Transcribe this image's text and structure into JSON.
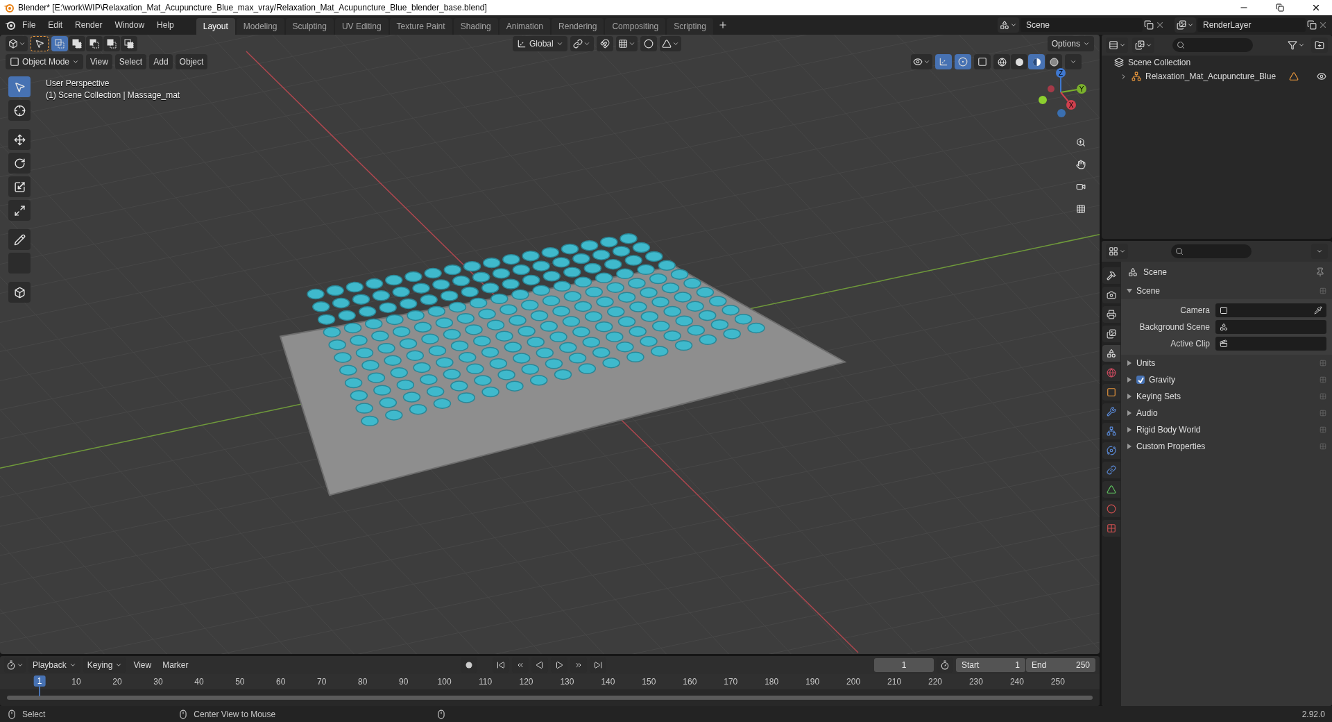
{
  "window": {
    "title": "Blender* [E:\\work\\WIP\\Relaxation_Mat_Acupuncture_Blue_max_vray/Relaxation_Mat_Acupuncture_Blue_blender_base.blend]"
  },
  "menu": [
    "File",
    "Edit",
    "Render",
    "Window",
    "Help"
  ],
  "workspaces": [
    {
      "label": "Layout",
      "selected": true
    },
    {
      "label": "Modeling",
      "selected": false
    },
    {
      "label": "Sculpting",
      "selected": false
    },
    {
      "label": "UV Editing",
      "selected": false
    },
    {
      "label": "Texture Paint",
      "selected": false
    },
    {
      "label": "Shading",
      "selected": false
    },
    {
      "label": "Animation",
      "selected": false
    },
    {
      "label": "Rendering",
      "selected": false
    },
    {
      "label": "Compositing",
      "selected": false
    },
    {
      "label": "Scripting",
      "selected": false
    }
  ],
  "scene": {
    "value": "Scene"
  },
  "view_layer": {
    "value": "RenderLayer"
  },
  "viewport": {
    "select_modes": [
      {
        "kind": "new",
        "selected": true
      },
      {
        "kind": "extend",
        "selected": false
      },
      {
        "kind": "subtract",
        "selected": false
      },
      {
        "kind": "difference",
        "selected": false
      },
      {
        "kind": "intersect",
        "selected": false
      }
    ],
    "orientation": "Global",
    "options": "Options",
    "mode": "Object Mode",
    "menus": [
      "View",
      "Select",
      "Add",
      "Object"
    ],
    "toggles": [
      {
        "kind": "gizmo",
        "on": true
      },
      {
        "kind": "overlay",
        "on": true
      },
      {
        "kind": "xray",
        "on": false
      }
    ],
    "shading": [
      {
        "kind": "wireframe",
        "selected": false
      },
      {
        "kind": "solid",
        "selected": false
      },
      {
        "kind": "material",
        "selected": true
      },
      {
        "kind": "rendered",
        "selected": false
      }
    ],
    "tools": [
      {
        "kind": "select",
        "selected": true
      },
      {
        "kind": "cursor",
        "selected": false
      },
      {
        "kind": "move",
        "selected": false
      },
      {
        "kind": "rotate",
        "selected": false
      },
      {
        "kind": "scale",
        "selected": false
      },
      {
        "kind": "transform",
        "selected": false
      },
      {
        "kind": "annotate",
        "selected": false
      },
      {
        "kind": "measure",
        "selected": false
      },
      {
        "kind": "add_cube",
        "selected": false
      }
    ],
    "overlay_text": [
      "User Perspective",
      "(1) Scene Collection | Massage_mat"
    ],
    "gizmo": {
      "x": "X",
      "y": "Y",
      "z": "Z"
    }
  },
  "outliner": {
    "title": "Scene Collection",
    "items": [
      {
        "label": "Relaxation_Mat_Acupuncture_Blue",
        "expanded": false,
        "visible": true
      }
    ]
  },
  "properties": {
    "tabs": [
      {
        "kind": "tool",
        "selected": false
      },
      {
        "kind": "render",
        "selected": false
      },
      {
        "kind": "output",
        "selected": false
      },
      {
        "kind": "view_layer",
        "selected": false
      },
      {
        "kind": "scene",
        "selected": true
      },
      {
        "kind": "world",
        "selected": false
      },
      {
        "kind": "object",
        "selected": false
      },
      {
        "kind": "modifiers",
        "selected": false
      },
      {
        "kind": "particles",
        "selected": false
      },
      {
        "kind": "physics",
        "selected": false
      },
      {
        "kind": "constraints",
        "selected": false
      },
      {
        "kind": "data",
        "selected": false
      },
      {
        "kind": "material",
        "selected": false
      },
      {
        "kind": "texture",
        "selected": false
      }
    ],
    "context": "Scene",
    "panels": [
      {
        "label": "Scene",
        "expanded": true,
        "fields": [
          {
            "label": "Camera",
            "kind": "camera"
          },
          {
            "label": "Background Scene",
            "kind": "scene"
          },
          {
            "label": "Active Clip",
            "kind": "clip"
          }
        ]
      },
      {
        "label": "Units",
        "expanded": false
      },
      {
        "label": "Gravity",
        "expanded": false,
        "checked": true
      },
      {
        "label": "Keying Sets",
        "expanded": false
      },
      {
        "label": "Audio",
        "expanded": false
      },
      {
        "label": "Rigid Body World",
        "expanded": false
      },
      {
        "label": "Custom Properties",
        "expanded": false
      }
    ]
  },
  "timeline": {
    "menus": [
      "Playback",
      "Keying",
      "View",
      "Marker"
    ],
    "frame": "1",
    "start_label": "Start",
    "start": "1",
    "end_label": "End",
    "end": "250",
    "current": "1",
    "ticks": [
      "10",
      "20",
      "30",
      "40",
      "50",
      "60",
      "70",
      "80",
      "90",
      "100",
      "110",
      "120",
      "130",
      "140",
      "150",
      "160",
      "170",
      "180",
      "190",
      "200",
      "210",
      "220",
      "230",
      "240",
      "250"
    ]
  },
  "status_bar": {
    "hints": [
      "Select",
      "Center View to Mouse"
    ],
    "version": "2.92.0"
  }
}
